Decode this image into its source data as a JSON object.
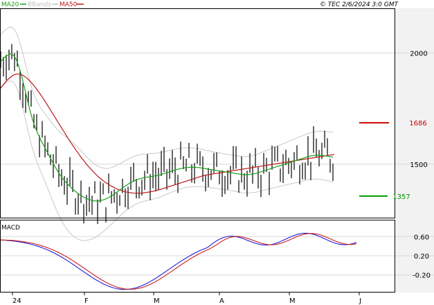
{
  "header": {
    "legend": [
      {
        "label": "MA20",
        "color": "#18a018"
      },
      {
        "label": "BBands",
        "color": "#c0c0c0"
      },
      {
        "label": "MA50",
        "color": "#b81818"
      }
    ],
    "copyright": "© TEC 2/6/2024 3:0 GMT"
  },
  "price_axis": {
    "ticks": [
      {
        "label": "2000",
        "value": 2000
      },
      {
        "label": "1500",
        "value": 1500
      }
    ]
  },
  "levels": [
    {
      "label": "1686",
      "value": 1686,
      "color": "#cc0000"
    },
    {
      "label": "1357",
      "value": 1357,
      "color": "#009900"
    }
  ],
  "macd_panel": {
    "title": "MACD",
    "ticks": [
      {
        "label": "0.60",
        "value": 0.6
      },
      {
        "label": "0.20",
        "value": 0.2
      },
      {
        "label": "-0.20",
        "value": -0.2
      }
    ]
  },
  "x_axis": {
    "labels": [
      "24",
      "F",
      "M",
      "A",
      "M",
      "J"
    ]
  },
  "colors": {
    "panel_bg": "#ffffff",
    "frame": "#000000",
    "axis_area": "#f2f2f2",
    "grid": "#d8d8d8",
    "candle": "#000000",
    "macd": "#1c1cd8",
    "signal": "#cc1c1c"
  },
  "chart_data": {
    "type": "line",
    "title": "",
    "description_note": "",
    "x": [
      1,
      3,
      5,
      7,
      9,
      11,
      13,
      15,
      17,
      19,
      21,
      23,
      25,
      27,
      29,
      31,
      33,
      35,
      37,
      39,
      41,
      43,
      45,
      47,
      49,
      51,
      53,
      55,
      57,
      59,
      61,
      63,
      65,
      67,
      69,
      71,
      73,
      75,
      77,
      79,
      81,
      83,
      85,
      87,
      89,
      91,
      93,
      95,
      97,
      99,
      101,
      103,
      105,
      107,
      109,
      111,
      113,
      115,
      117,
      119,
      121,
      123,
      125,
      127,
      129,
      131,
      133,
      135,
      137,
      139,
      141,
      143,
      145,
      147,
      149,
      151,
      153,
      155,
      157,
      159,
      161,
      163,
      165,
      167,
      169,
      171,
      173,
      175,
      177,
      179,
      181,
      183,
      185,
      187,
      189,
      191,
      193,
      195,
      197,
      199,
      201,
      203,
      205,
      207,
      209,
      211,
      213,
      215,
      217,
      219,
      221,
      223,
      225,
      227,
      229,
      231,
      233,
      235,
      237,
      239,
      241,
      243,
      245,
      247,
      249,
      251,
      253,
      255,
      257,
      259,
      261,
      263,
      265,
      267,
      269,
      271,
      273,
      275,
      277,
      279,
      281,
      283,
      285,
      287,
      289,
      291,
      293,
      295,
      297,
      299,
      301,
      303,
      305,
      307,
      309,
      311,
      313,
      315,
      317,
      319,
      321,
      323,
      325,
      327,
      329,
      331,
      333,
      335,
      337,
      339,
      341,
      343,
      345,
      347,
      349,
      351,
      353,
      355,
      357,
      359,
      361,
      363,
      365,
      367,
      369,
      371,
      373,
      375,
      377,
      379,
      381,
      383,
      385,
      387,
      389,
      391,
      393,
      395,
      397,
      399,
      401,
      403,
      405,
      407,
      409,
      411,
      413,
      415,
      417,
      419,
      421,
      423,
      425,
      427,
      429,
      431,
      433,
      435,
      437,
      439,
      441,
      443,
      445,
      447,
      449,
      451,
      453,
      455,
      457,
      459,
      461,
      463,
      465,
      467,
      469,
      471,
      473,
      475,
      477,
      479,
      481,
      483,
      485,
      487,
      489,
      491,
      493,
      495,
      497,
      499,
      501,
      503,
      505,
      507,
      509,
      511,
      513,
      515
    ],
    "series": [
      {
        "name": "MA20",
        "values": [
          1960,
          1968,
          1975,
          1981,
          1986,
          1990,
          1993,
          1995,
          1994,
          1990,
          1983,
          1972,
          1958,
          1940,
          1920,
          1898,
          1874,
          1849,
          1822,
          1796,
          1770,
          1745,
          1722,
          1701,
          1682,
          1665,
          1649,
          1635,
          1622,
          1609,
          1597,
          1585,
          1574,
          1562,
          1550,
          1538,
          1526,
          1514,
          1503,
          1492,
          1481,
          1470,
          1460,
          1451,
          1442,
          1434,
          1427,
          1420,
          1413,
          1406,
          1400,
          1394,
          1388,
          1383,
          1378,
          1373,
          1368,
          1364,
          1360,
          1356,
          1352,
          1349,
          1346,
          1344,
          1341,
          1339,
          1337,
          1336,
          1335,
          1335,
          1335,
          1336,
          1337,
          1338,
          1340,
          1342,
          1344,
          1347,
          1350,
          1354,
          1358,
          1362,
          1366,
          1371,
          1375,
          1380,
          1384,
          1389,
          1393,
          1398,
          1402,
          1406,
          1410,
          1414,
          1418,
          1421,
          1424,
          1427,
          1430,
          1432,
          1434,
          1436,
          1437,
          1439,
          1440,
          1441,
          1442,
          1443,
          1444,
          1445,
          1446,
          1447,
          1448,
          1449,
          1451,
          1452,
          1454,
          1456,
          1458,
          1460,
          1462,
          1464,
          1466,
          1468,
          1470,
          1472,
          1474,
          1476,
          1477,
          1479,
          1480,
          1482,
          1483,
          1484,
          1485,
          1485,
          1486,
          1486,
          1486,
          1486,
          1486,
          1486,
          1485,
          1485,
          1484,
          1483,
          1482,
          1481,
          1480,
          1479,
          1478,
          1477,
          1476,
          1475,
          1474,
          1473,
          1472,
          1471,
          1470,
          1469,
          1468,
          1467,
          1466,
          1465,
          1464,
          1463,
          1462,
          1461,
          1460,
          1459,
          1458,
          1457,
          1456,
          1455,
          1454,
          1453,
          1453,
          1453,
          1453,
          1453,
          1454,
          1455,
          1456,
          1457,
          1458,
          1460,
          1462,
          1464,
          1466,
          1468,
          1470,
          1472,
          1474,
          1476,
          1478,
          1480,
          1482,
          1484,
          1486,
          1488,
          1490,
          1492,
          1494,
          1496,
          1498,
          1500,
          1502,
          1504,
          1506,
          1508,
          1510,
          1512,
          1514,
          1516,
          1518,
          1520,
          1522,
          1524,
          1526,
          1528,
          1530,
          1532,
          1534,
          1536,
          1537,
          1538,
          1539,
          1540,
          1540,
          1540,
          1540,
          1540,
          1540,
          1539,
          1538,
          1537,
          1536,
          1535,
          1534,
          1533,
          1532
        ]
      },
      {
        "name": "MA50",
        "values": [
          1842,
          1850,
          1858,
          1866,
          1873,
          1879,
          1885,
          1890,
          1895,
          1899,
          1902,
          1904,
          1905,
          1905,
          1904,
          1902,
          1899,
          1895,
          1891,
          1886,
          1880,
          1874,
          1867,
          1860,
          1853,
          1845,
          1837,
          1828,
          1820,
          1811,
          1802,
          1792,
          1783,
          1773,
          1763,
          1753,
          1743,
          1733,
          1723,
          1713,
          1703,
          1693,
          1683,
          1673,
          1663,
          1653,
          1643,
          1633,
          1623,
          1613,
          1603,
          1594,
          1585,
          1576,
          1567,
          1558,
          1549,
          1540,
          1532,
          1524,
          1516,
          1508,
          1500,
          1493,
          1486,
          1479,
          1472,
          1465,
          1459,
          1453,
          1447,
          1441,
          1436,
          1431,
          1426,
          1421,
          1417,
          1413,
          1409,
          1405,
          1401,
          1398,
          1395,
          1392,
          1389,
          1386,
          1384,
          1382,
          1380,
          1378,
          1376,
          1375,
          1374,
          1373,
          1372,
          1371,
          1370,
          1370,
          1370,
          1370,
          1370,
          1370,
          1371,
          1371,
          1372,
          1373,
          1374,
          1375,
          1376,
          1377,
          1378,
          1380,
          1381,
          1383,
          1385,
          1386,
          1388,
          1390,
          1392,
          1394,
          1396,
          1398,
          1400,
          1402,
          1404,
          1406,
          1408,
          1410,
          1412,
          1414,
          1416,
          1418,
          1420,
          1422,
          1424,
          1426,
          1428,
          1430,
          1432,
          1434,
          1436,
          1438,
          1440,
          1442,
          1444,
          1446,
          1448,
          1450,
          1451,
          1452,
          1453,
          1454,
          1455,
          1456,
          1457,
          1458,
          1459,
          1460,
          1461,
          1462,
          1463,
          1464,
          1465,
          1466,
          1467,
          1468,
          1469,
          1470,
          1471,
          1472,
          1473,
          1474,
          1475,
          1476,
          1477,
          1478,
          1479,
          1480,
          1481,
          1482,
          1483,
          1484,
          1485,
          1486,
          1487,
          1488,
          1489,
          1490,
          1491,
          1492,
          1493,
          1494,
          1495,
          1496,
          1497,
          1498,
          1499,
          1500,
          1501,
          1502,
          1503,
          1504,
          1505,
          1506,
          1507,
          1508,
          1509,
          1510,
          1511,
          1512,
          1513,
          1514,
          1515,
          1516,
          1517,
          1518,
          1519,
          1520,
          1521,
          1522,
          1523,
          1524,
          1525,
          1526,
          1527,
          1528,
          1529,
          1530,
          1531,
          1532,
          1533,
          1534,
          1535,
          1536,
          1537,
          1538,
          1539,
          1540,
          1541,
          1542,
          1543,
          1544
        ]
      }
    ],
    "ylim": [
      1260,
      2200
    ],
    "grid": true,
    "legend_position": "top-left"
  }
}
